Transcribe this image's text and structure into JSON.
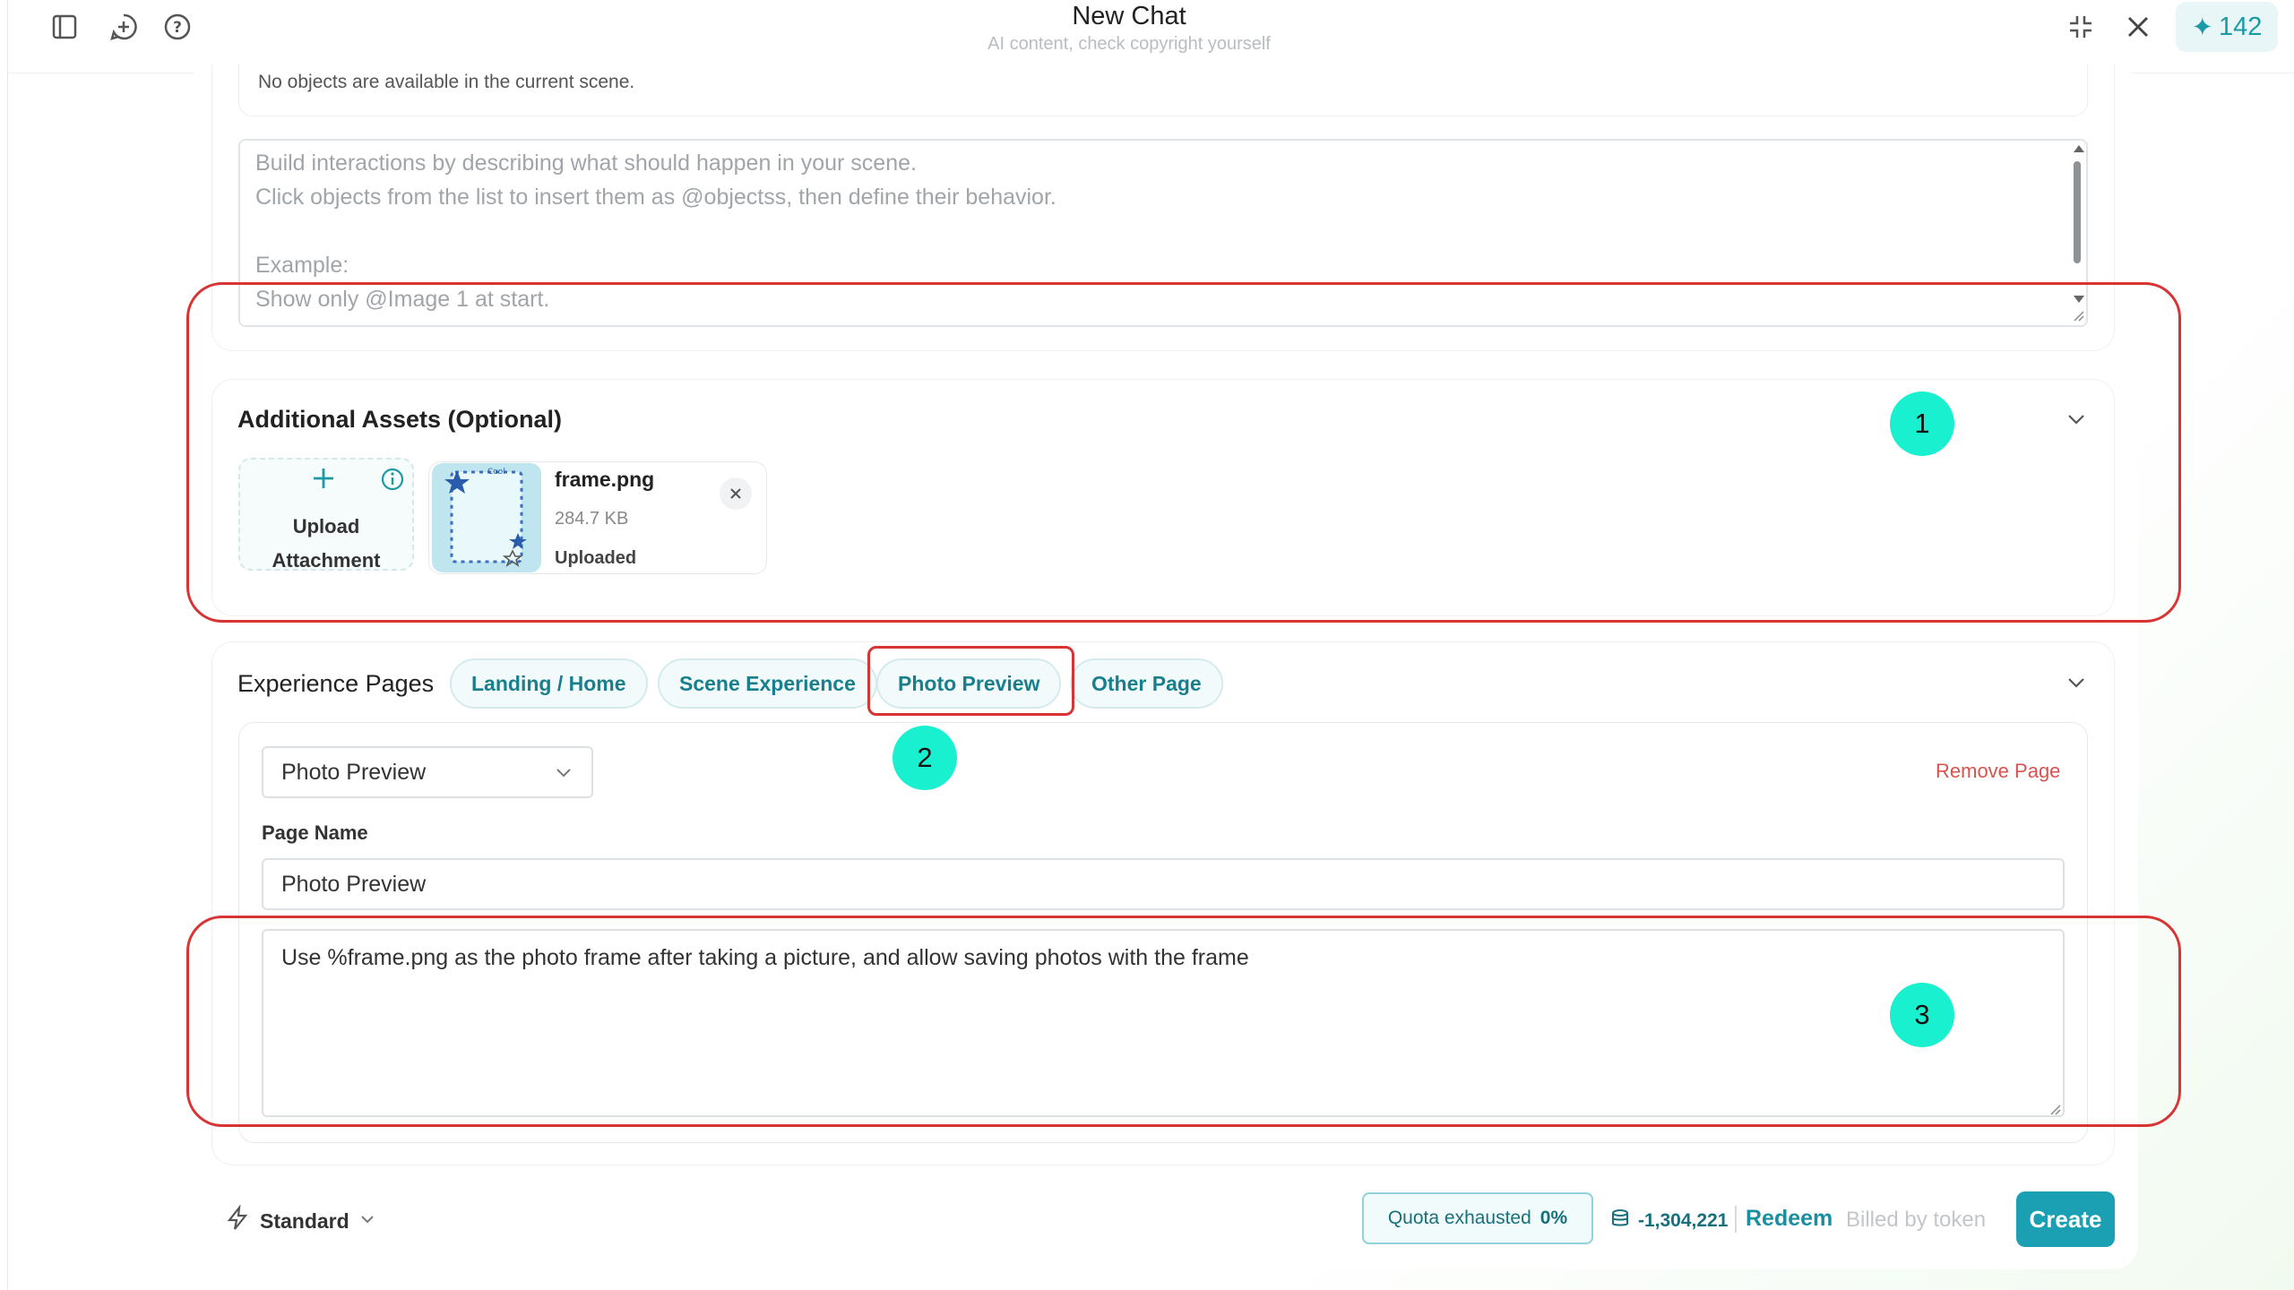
{
  "header": {
    "title": "New Chat",
    "subtitle": "AI content, check copyright yourself",
    "credits": "142"
  },
  "scene_objects": {
    "empty_text": "No objects are available in the current scene."
  },
  "interactions": {
    "placeholder_lines": [
      "Build interactions by describing what should happen in your scene.",
      "Click objects from the list to insert them as @objectss, then define their behavior.",
      "Example:",
      "Show only @Image 1 at start."
    ]
  },
  "assets": {
    "title": "Additional Assets (Optional)",
    "upload_line1": "Upload",
    "upload_line2": "Attachment",
    "thumb_text": "Cool",
    "file": {
      "name": "frame.png",
      "size": "284.7 KB",
      "status": "Uploaded"
    }
  },
  "pages": {
    "title": "Experience Pages",
    "tabs": [
      "Landing / Home",
      "Scene Experience",
      "Photo Preview",
      "Other Page"
    ],
    "selected_page": "Photo Preview",
    "remove_label": "Remove Page",
    "page_name_label": "Page Name",
    "page_name_value": "Photo Preview",
    "description": "Use %frame.png as the photo frame after taking a picture, and allow saving photos with the frame"
  },
  "annotations": [
    "1",
    "2",
    "3"
  ],
  "footer": {
    "mode": "Standard",
    "quota_label": "Quota exhausted",
    "quota_percent": "0%",
    "token_balance": "-1,304,221",
    "redeem": "Redeem",
    "billing": "Billed by token",
    "create": "Create"
  },
  "colors": {
    "accent": "#1aa0b2",
    "annotation_red": "#d93434",
    "badge": "#19f0d0",
    "remove": "#d9534f"
  }
}
